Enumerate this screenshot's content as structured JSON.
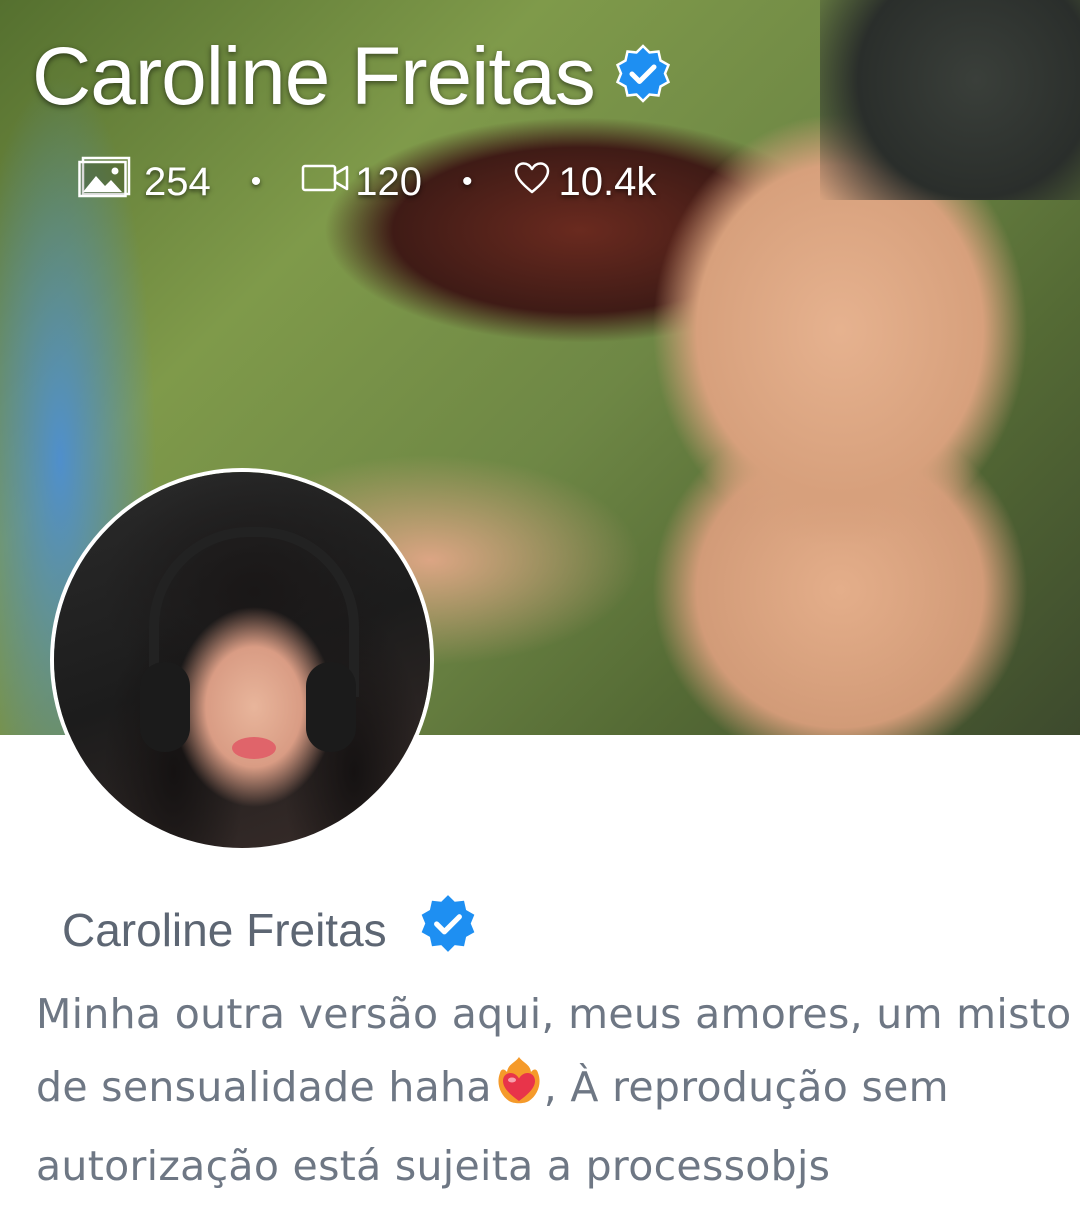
{
  "banner": {
    "title": "Caroline Freitas",
    "verified_icon": "verified-badge-icon",
    "stats": {
      "photos": "254",
      "videos": "120",
      "likes": "10.4k",
      "separator": "•"
    }
  },
  "profile": {
    "name": "Caroline Freitas",
    "verified_icon": "verified-badge-icon",
    "bio_part1": "Minha outra versão aqui, meus amores, um misto de sensualidade haha",
    "bio_emoji": "heart-on-fire-icon",
    "bio_part2": ", À reprodução sem autorização está sujeita a processobjs"
  },
  "colors": {
    "verified_blue": "#1e8ff2",
    "name_gray": "#5d6673",
    "bio_gray": "#6e7784"
  }
}
